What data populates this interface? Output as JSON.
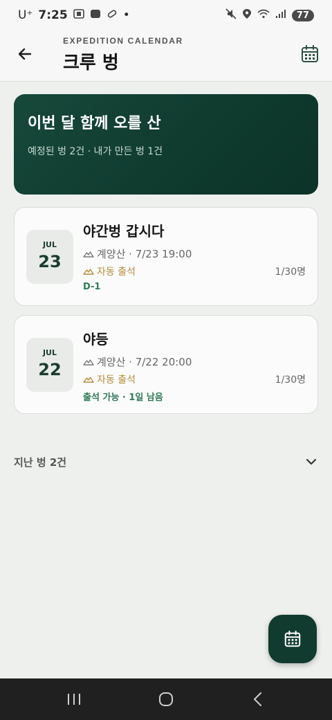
{
  "status_bar": {
    "carrier": "U⁺",
    "time": "7:25",
    "dot": "•",
    "battery": "77"
  },
  "header": {
    "subtitle": "EXPEDITION CALENDAR",
    "title": "크루 벙"
  },
  "hero": {
    "title": "이번 달 함께 오를 산",
    "summary": "예정된 벙 2건 · 내가 만든 벙 1건"
  },
  "events": [
    {
      "month": "JUL",
      "day": "23",
      "title": "야간벙 갑시다",
      "meta": "계양산 · 7/23 19:00",
      "auto": "자동 출석",
      "count": "1/30명",
      "tag": "D-1"
    },
    {
      "month": "JUL",
      "day": "22",
      "title": "야등",
      "meta": "계양산 · 7/22 20:00",
      "auto": "자동 출석",
      "count": "1/30명",
      "tag": "출석 가능 · 1일 남음"
    }
  ],
  "past": {
    "label": "지난 벙 2건"
  },
  "colors": {
    "brand": "#113b2f",
    "accent_gold": "#b58b3a",
    "tag_green": "#2f7a55"
  }
}
